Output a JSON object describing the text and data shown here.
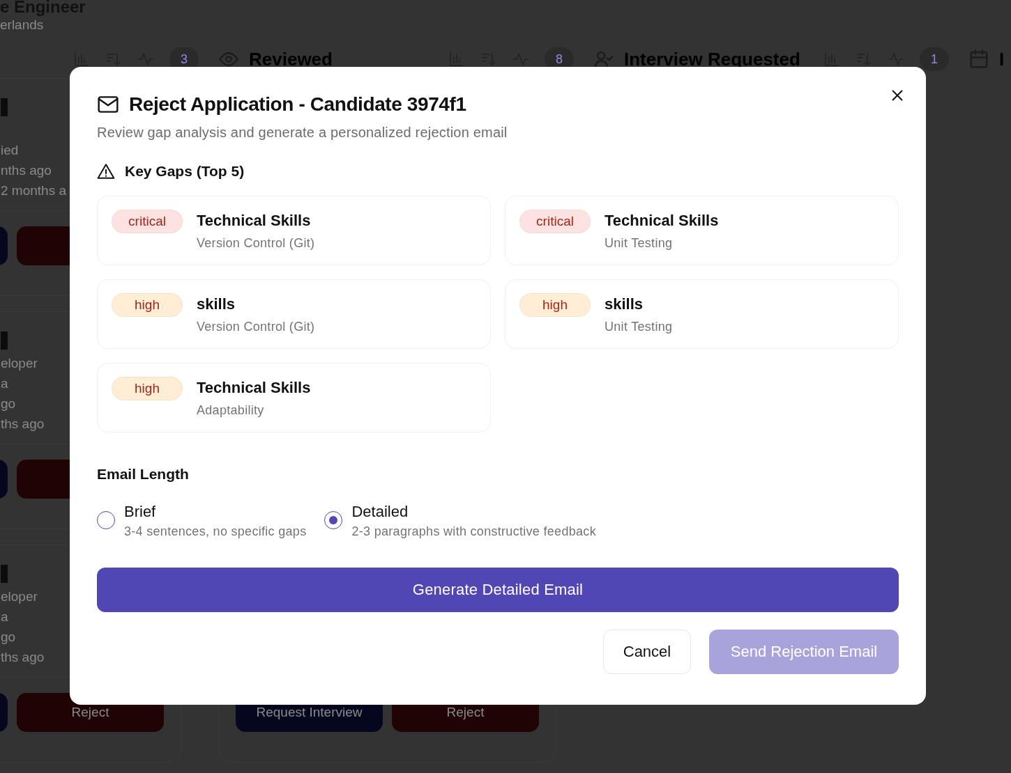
{
  "board": {
    "job_title": "e Engineer",
    "location": "erlands",
    "columns": [
      {
        "count": "3",
        "cards": [
          {
            "lines": [
              "ied",
              "nths ago",
              "2 months a"
            ],
            "buttons": [
              {
                "kind": "interview"
              },
              {
                "kind": "reject"
              }
            ]
          },
          {
            "lines": [
              "eloper",
              "a",
              "go",
              "ths ago"
            ],
            "buttons": [
              {
                "kind": "interview"
              },
              {
                "kind": "reject"
              }
            ]
          },
          {
            "lines": [
              "eloper",
              "a",
              "go",
              "ths ago"
            ],
            "buttons": [
              {
                "kind": "interview"
              },
              {
                "kind": "reject",
                "label": "Reject"
              }
            ]
          }
        ]
      },
      {
        "title": "Reviewed",
        "count": "8",
        "cards": [
          {
            "buttons": [
              {
                "kind": "interview",
                "label": "Request Interview"
              },
              {
                "kind": "reject",
                "label": "Reject"
              }
            ]
          }
        ]
      },
      {
        "title": "Interview Requested",
        "count": "1"
      },
      {
        "title": "I"
      }
    ]
  },
  "dialog": {
    "title": "Reject Application - Candidate 3974f1",
    "subtitle": "Review gap analysis and generate a personalized rejection email",
    "gaps_heading": "Key Gaps (Top 5)",
    "gaps": [
      {
        "severity": "critical",
        "color": "#fde2e2",
        "category": "Technical Skills",
        "skill": "Version Control (Git)"
      },
      {
        "severity": "critical",
        "color": "#fde2e2",
        "category": "Technical Skills",
        "skill": "Unit Testing"
      },
      {
        "severity": "high",
        "color": "#ffedd5",
        "category": "skills",
        "skill": "Version Control (Git)"
      },
      {
        "severity": "high",
        "color": "#ffedd5",
        "category": "skills",
        "skill": "Unit Testing"
      },
      {
        "severity": "high",
        "color": "#ffedd5",
        "category": "Technical Skills",
        "skill": "Adaptability"
      }
    ],
    "length_heading": "Email Length",
    "length_options": [
      {
        "label": "Brief",
        "description": "3-4 sentences, no specific gaps",
        "selected": false
      },
      {
        "label": "Detailed",
        "description": "2-3 paragraphs with constructive feedback",
        "selected": true
      }
    ],
    "generate_button": "Generate Detailed Email",
    "cancel_button": "Cancel",
    "send_button": {
      "label": "Send Rejection Email",
      "disabled": true
    }
  }
}
